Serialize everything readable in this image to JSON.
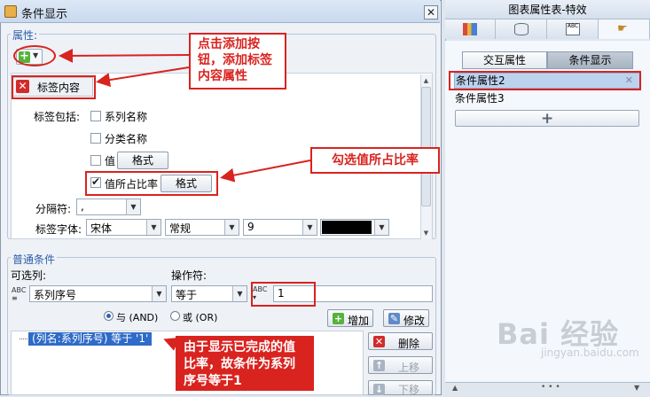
{
  "dialog": {
    "title": "条件显示",
    "close_glyph": "✕",
    "props_label": "属性:",
    "prop_header": "标签内容",
    "labels_include": "标签包括:",
    "options": [
      {
        "label": "系列名称",
        "checked": false
      },
      {
        "label": "分类名称",
        "checked": false
      },
      {
        "label": "值",
        "checked": false,
        "button": "格式"
      },
      {
        "label": "值所占比率",
        "checked": true,
        "button": "格式"
      }
    ],
    "separator_label": "分隔符:",
    "separator_value": ",",
    "font_label": "标签字体:",
    "font_family": "宋体",
    "font_style": "常规",
    "font_size": "9",
    "font_color": "#000000"
  },
  "conditions": {
    "group_label": "普通条件",
    "column_label": "可选列:",
    "column_value": "系列序号",
    "operator_label": "操作符:",
    "operator_value": "等于",
    "value": "1",
    "and_label": "与 (AND)",
    "or_label": "或 (OR)",
    "and_selected": true,
    "add_button": "增加",
    "edit_button": "修改",
    "delete_button": "删除",
    "up_button": "上移",
    "down_button": "下移",
    "list_item": "(列名:系列序号) 等于 '1'"
  },
  "right_panel": {
    "title": "图表属性表-特效",
    "tabs": [
      "chart-icon",
      "data-icon",
      "text-icon",
      "hand-icon"
    ],
    "seg_interactive": "交互属性",
    "seg_condition": "条件显示",
    "items": [
      "条件属性2",
      "条件属性3"
    ],
    "item_close": "✕"
  },
  "annotations": {
    "note1": "点击添加按钮，添加标签内容属性",
    "note2": "勾选值所占比率",
    "note3": "由于显示已完成的值比率，故条件为系列序号等于1"
  },
  "watermark": {
    "brand": "Bai 经验",
    "sub": "jingyan.baidu.com"
  },
  "colors": {
    "accent_red": "#d9231f",
    "selection_blue": "#2f6bc8",
    "group_label_blue": "#2d5da8"
  }
}
